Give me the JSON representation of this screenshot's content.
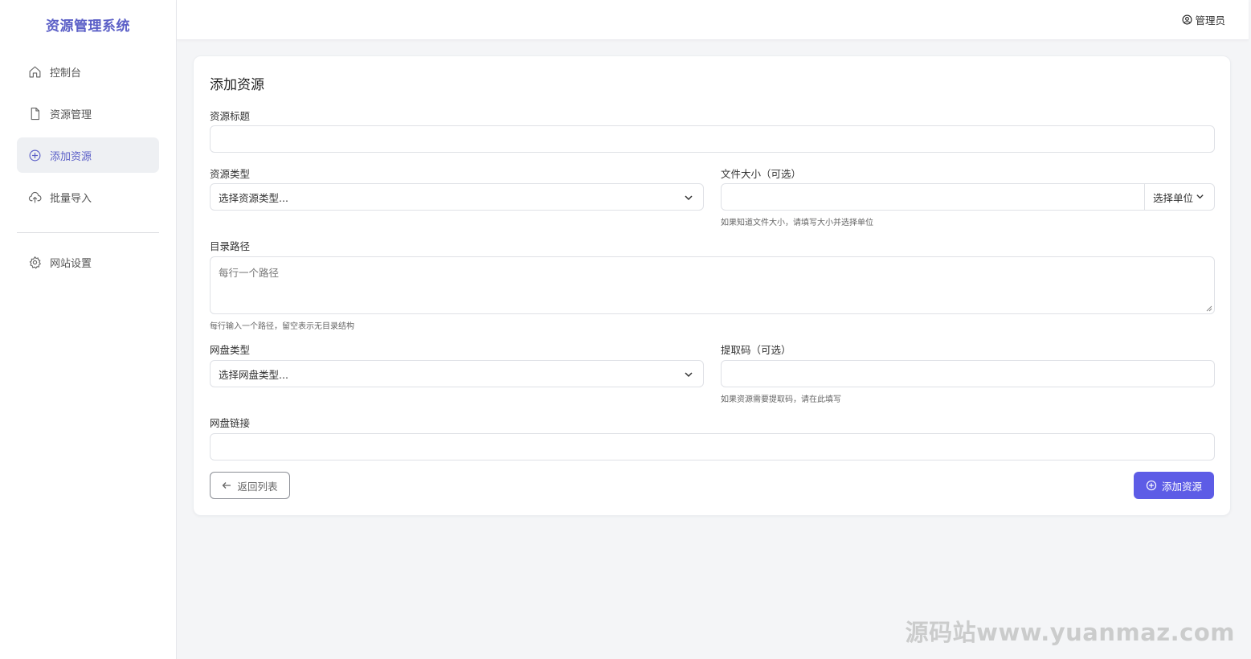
{
  "app": {
    "title": "资源管理系统"
  },
  "sidebar": {
    "items": [
      {
        "label": "控制台",
        "icon": "home-icon",
        "active": false
      },
      {
        "label": "资源管理",
        "icon": "file-icon",
        "active": false
      },
      {
        "label": "添加资源",
        "icon": "plus-circle-icon",
        "active": true
      },
      {
        "label": "批量导入",
        "icon": "cloud-upload-icon",
        "active": false
      }
    ],
    "settings": {
      "label": "网站设置",
      "icon": "gear-icon"
    }
  },
  "header": {
    "user_label": "管理员",
    "user_icon": "user-circle-icon"
  },
  "form": {
    "title": "添加资源",
    "resource_title": {
      "label": "资源标题",
      "value": ""
    },
    "resource_type": {
      "label": "资源类型",
      "selected": "选择资源类型..."
    },
    "file_size": {
      "label": "文件大小（可选）",
      "value": "",
      "unit_selected": "选择单位",
      "help": "如果知道文件大小，请填写大小并选择单位"
    },
    "directory_path": {
      "label": "目录路径",
      "placeholder": "每行一个路径",
      "help": "每行输入一个路径，留空表示无目录结构"
    },
    "disk_type": {
      "label": "网盘类型",
      "selected": "选择网盘类型..."
    },
    "extract_code": {
      "label": "提取码（可选）",
      "value": "",
      "help": "如果资源需要提取码，请在此填写"
    },
    "disk_link": {
      "label": "网盘链接",
      "value": ""
    },
    "back_button": "返回列表",
    "submit_button": "添加资源"
  },
  "watermark": "源码站www.yuanmaz.com",
  "colors": {
    "accent": "#5d5ce6",
    "brand": "#5b5fc7",
    "background": "#f4f5f7"
  }
}
